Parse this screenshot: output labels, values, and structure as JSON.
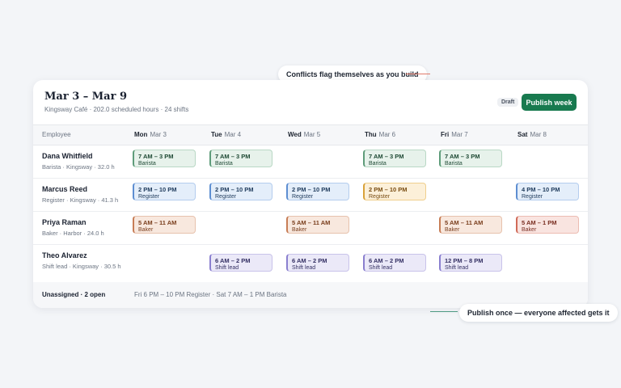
{
  "callouts": {
    "top": "Conflicts flag themselves as you build",
    "bottom": "Publish once — everyone affected gets it"
  },
  "schedule": {
    "title": "Mar 3 – Mar 9",
    "subtitle": "Kingsway Café · 202.0 scheduled hours · 24 shifts",
    "status_badge": "Draft",
    "publish_label": "Publish week"
  },
  "columns": {
    "employee": "Employee",
    "days": [
      {
        "day": "Mon",
        "date": "Mar 3"
      },
      {
        "day": "Tue",
        "date": "Mar 4"
      },
      {
        "day": "Wed",
        "date": "Mar 5"
      },
      {
        "day": "Thu",
        "date": "Mar 6"
      },
      {
        "day": "Fri",
        "date": "Mar 7"
      },
      {
        "day": "Sat",
        "date": "Mar 8"
      }
    ]
  },
  "employees": [
    {
      "name": "Dana Whitfield",
      "meta": "Barista · Kingsway · 32.0 h"
    },
    {
      "name": "Marcus Reed",
      "meta": "Register · Kingsway · 41.3 h"
    },
    {
      "name": "Priya Raman",
      "meta": "Baker · Harbor · 24.0 h"
    },
    {
      "name": "Theo Alvarez",
      "meta": "Shift lead · Kingsway · 30.5 h"
    }
  ],
  "shifts": {
    "dana_mon": {
      "time": "7 AM – 3 PM",
      "role": "Barista"
    },
    "dana_tue": {
      "time": "7 AM – 3 PM",
      "role": "Barista"
    },
    "dana_thu": {
      "time": "7 AM – 3 PM",
      "role": "Barista"
    },
    "dana_fri": {
      "time": "7 AM – 3 PM",
      "role": "Barista"
    },
    "marcus_mon": {
      "time": "2 PM – 10 PM",
      "role": "Register"
    },
    "marcus_tue": {
      "time": "2 PM – 10 PM",
      "role": "Register"
    },
    "marcus_wed": {
      "time": "2 PM – 10 PM",
      "role": "Register"
    },
    "marcus_thu": {
      "time": "2 PM – 10 PM",
      "role": "Register"
    },
    "marcus_sat": {
      "time": "4 PM – 10 PM",
      "role": "Register"
    },
    "priya_mon": {
      "time": "5 AM – 11 AM",
      "role": "Baker"
    },
    "priya_wed": {
      "time": "5 AM – 11 AM",
      "role": "Baker"
    },
    "priya_fri": {
      "time": "5 AM – 11 AM",
      "role": "Baker"
    },
    "priya_sat": {
      "time": "5 AM – 1 PM",
      "role": "Baker"
    },
    "theo_tue": {
      "time": "6 AM – 2 PM",
      "role": "Shift lead"
    },
    "theo_wed": {
      "time": "6 AM – 2 PM",
      "role": "Shift lead"
    },
    "theo_thu": {
      "time": "6 AM – 2 PM",
      "role": "Shift lead"
    },
    "theo_fri": {
      "time": "12 PM – 8 PM",
      "role": "Shift lead"
    }
  },
  "unassigned": {
    "label": "Unassigned · 2 open",
    "shifts": "Fri 6 PM – 10 PM Register · Sat 7 AM – 1 PM Barista"
  },
  "colors": {
    "accent": "#187a4f",
    "conflict": "#d9a23a",
    "background": "#f3f5f8"
  }
}
